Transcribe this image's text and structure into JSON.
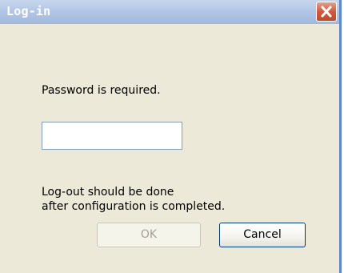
{
  "window": {
    "title": "Log-in"
  },
  "dialog": {
    "password_prompt": "Password is required.",
    "password_value": "",
    "note_line1": "Log-out should be done",
    "note_line2": "after configuration is completed.",
    "ok_label": "OK",
    "cancel_label": "Cancel",
    "ok_enabled": false
  },
  "icons": {
    "close": "close-icon"
  },
  "colors": {
    "titlebar": "#b2c7e6",
    "close_button": "#cf5a3e",
    "dialog_background": "#ece9d8",
    "input_border": "#7f9db9",
    "default_button_border": "#003c74"
  }
}
